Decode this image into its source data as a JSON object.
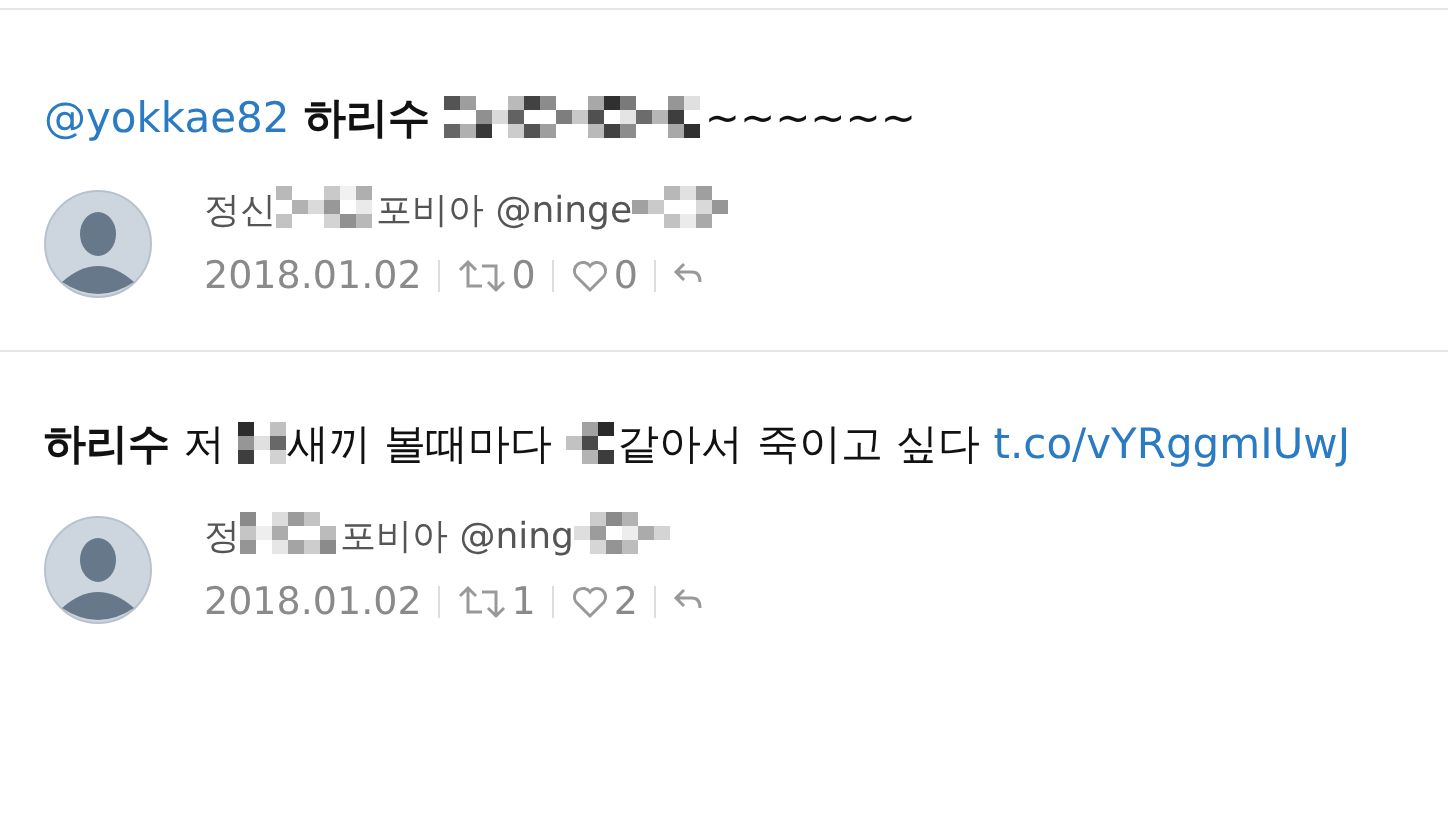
{
  "tweets": [
    {
      "text": [
        {
          "kind": "mention",
          "text": "@yokkae82"
        },
        {
          "kind": "bold",
          "text": " 하리수 "
        },
        {
          "kind": "redacted"
        },
        {
          "kind": "text",
          "text": "~~~~~~"
        }
      ],
      "author": [
        {
          "kind": "text",
          "text": "정신"
        },
        {
          "kind": "redacted"
        },
        {
          "kind": "text",
          "text": "포비아 @ninge"
        },
        {
          "kind": "redacted"
        }
      ],
      "date": "2018.01.02",
      "retweets": "0",
      "likes": "0"
    },
    {
      "text": [
        {
          "kind": "bold",
          "text": "하리수"
        },
        {
          "kind": "text",
          "text": " 저 "
        },
        {
          "kind": "redacted"
        },
        {
          "kind": "text",
          "text": "새끼 볼때마다 "
        },
        {
          "kind": "redacted"
        },
        {
          "kind": "text",
          "text": "같아서 죽이고 싶다 "
        },
        {
          "kind": "link",
          "text": "t.co/vYRggmIUwJ"
        }
      ],
      "author": [
        {
          "kind": "text",
          "text": "정"
        },
        {
          "kind": "redacted"
        },
        {
          "kind": "text",
          "text": "포비아 @ning"
        },
        {
          "kind": "redacted"
        }
      ],
      "date": "2018.01.02",
      "retweets": "1",
      "likes": "2"
    }
  ]
}
